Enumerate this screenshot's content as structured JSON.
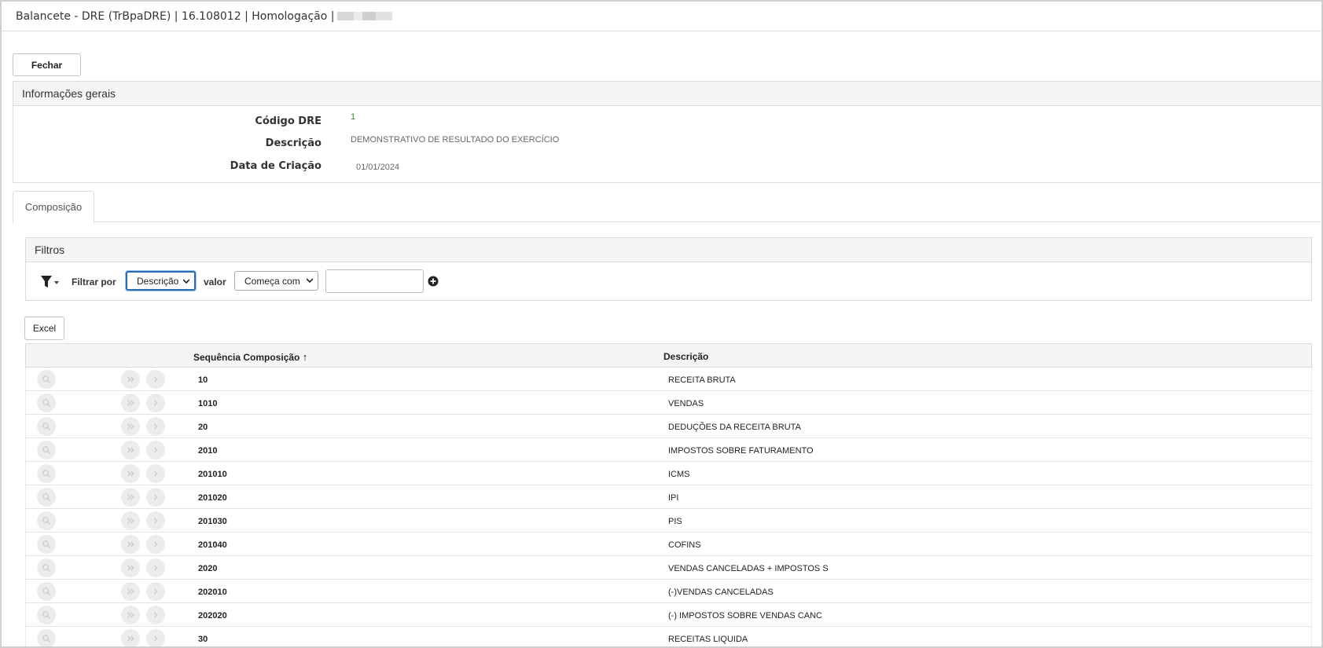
{
  "window": {
    "title": "Balancete - DRE (TrBpaDRE) | 16.108012 | Homologação | "
  },
  "toolbar": {
    "close_label": "Fechar",
    "excel_label": "Excel"
  },
  "general_info": {
    "heading": "Informações gerais",
    "fields": [
      {
        "label": "Código DRE",
        "value": "1"
      },
      {
        "label": "Descrição",
        "value": "DEMONSTRATIVO DE RESULTADO DO EXERCÍCIO"
      },
      {
        "label": "Data de Criação",
        "value": "01/01/2024"
      }
    ]
  },
  "tabs": [
    {
      "label": "Composição",
      "active": true
    }
  ],
  "filters": {
    "heading": "Filtros",
    "filter_by_label": "Filtrar por",
    "field_select": "Descrição",
    "value_label": "valor",
    "operator_select": "Começa com",
    "value_input": ""
  },
  "grid": {
    "columns": [
      "Sequência Composição",
      "Descrição"
    ],
    "sort_indicator": "↑",
    "rows": [
      {
        "seq": "10",
        "desc": "RECEITA BRUTA"
      },
      {
        "seq": "1010",
        "desc": "VENDAS"
      },
      {
        "seq": "20",
        "desc": "DEDUÇÕES DA RECEITA BRUTA"
      },
      {
        "seq": "2010",
        "desc": "IMPOSTOS SOBRE FATURAMENTO"
      },
      {
        "seq": "201010",
        "desc": "ICMS"
      },
      {
        "seq": "201020",
        "desc": "IPI"
      },
      {
        "seq": "201030",
        "desc": "PIS"
      },
      {
        "seq": "201040",
        "desc": "COFINS"
      },
      {
        "seq": "2020",
        "desc": "VENDAS CANCELADAS + IMPOSTOS S"
      },
      {
        "seq": "202010",
        "desc": "(-)VENDAS CANCELADAS"
      },
      {
        "seq": "202020",
        "desc": "(-) IMPOSTOS SOBRE VENDAS CANC"
      },
      {
        "seq": "30",
        "desc": "RECEITAS LIQUIDA"
      }
    ]
  },
  "colors": {
    "border": "#dcdcdc",
    "header_bg": "#f5f5f5",
    "focus_blue": "#2b6cb0",
    "row_button_bg": "#ececec"
  }
}
